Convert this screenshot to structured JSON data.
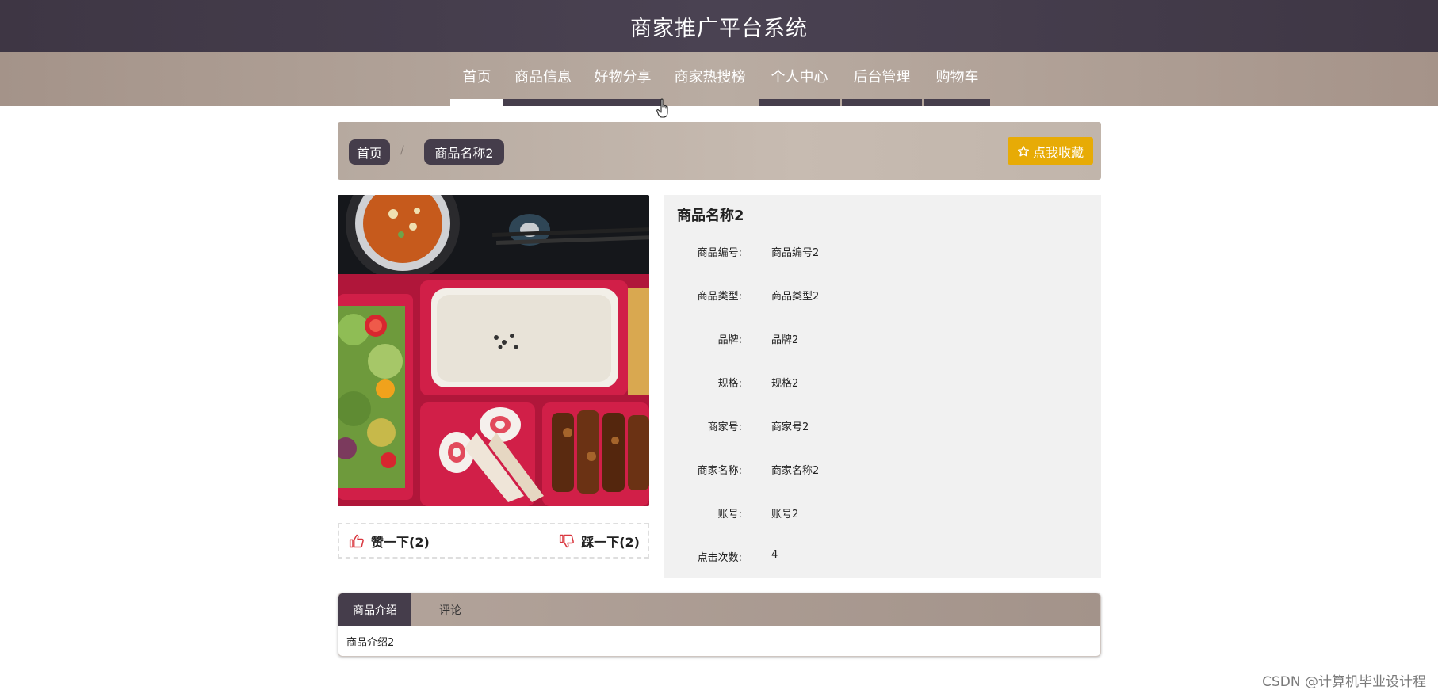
{
  "header": {
    "title": "商家推广平台系统"
  },
  "nav": {
    "items": [
      {
        "label": "首页"
      },
      {
        "label": "商品信息"
      },
      {
        "label": "好物分享"
      },
      {
        "label": "商家热搜榜"
      },
      {
        "label": "个人中心"
      },
      {
        "label": "后台管理"
      },
      {
        "label": "购物车"
      }
    ]
  },
  "breadcrumb": {
    "home": "首页",
    "separator": "/",
    "current": "商品名称2"
  },
  "collect_button": {
    "label": "点我收藏",
    "icon": "star-outline-icon",
    "color": "#e7ab06"
  },
  "product": {
    "name": "商品名称2",
    "fields": [
      {
        "label": "商品编号:",
        "value": "商品编号2"
      },
      {
        "label": "商品类型:",
        "value": "商品类型2"
      },
      {
        "label": "品牌:",
        "value": "品牌2"
      },
      {
        "label": "规格:",
        "value": "规格2"
      },
      {
        "label": "商家号:",
        "value": "商家号2"
      },
      {
        "label": "商家名称:",
        "value": "商家名称2"
      },
      {
        "label": "账号:",
        "value": "账号2"
      },
      {
        "label": "点击次数:",
        "value": "4"
      }
    ]
  },
  "votes": {
    "like_label": "赞一下(2)",
    "dislike_label": "踩一下(2)",
    "icon_color": "#d9363e"
  },
  "tabs": {
    "items": [
      {
        "label": "商品介绍"
      },
      {
        "label": "评论"
      }
    ],
    "content": "商品介绍2"
  },
  "theme": {
    "dark": "#453d4b",
    "taupe": "#a59389"
  },
  "watermark": "CSDN @计算机毕业设计程"
}
